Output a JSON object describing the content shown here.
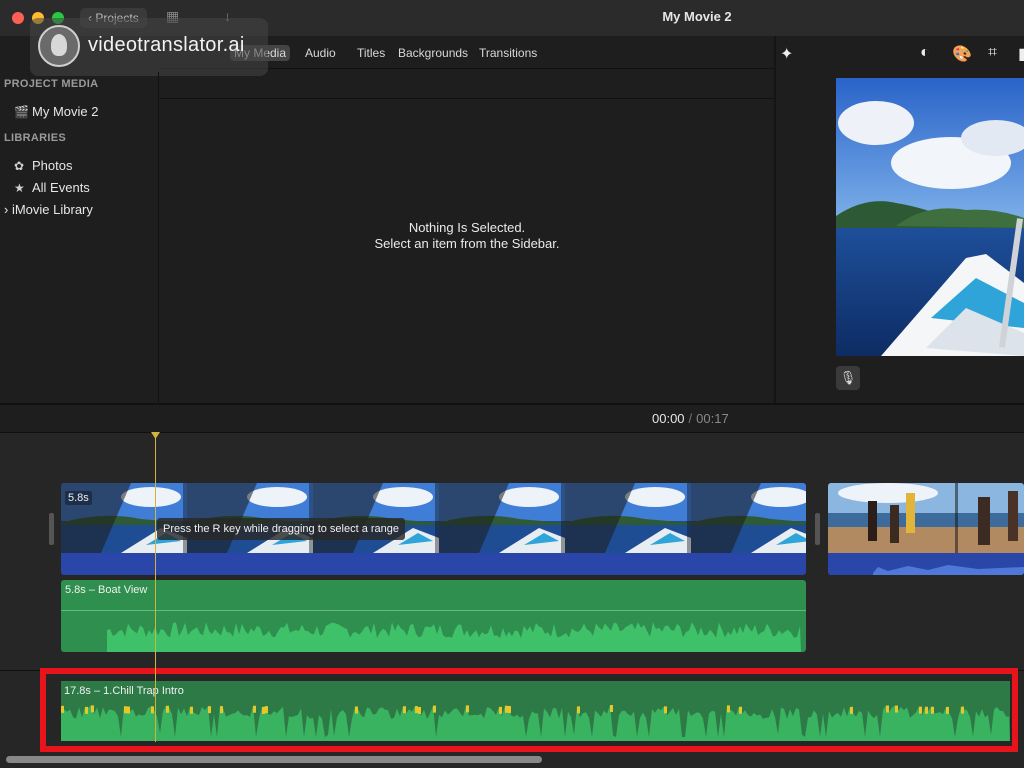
{
  "titlebar": {
    "projects_label": "Projects",
    "window_title": "My Movie 2"
  },
  "watermark": {
    "text": "videotranslator.ai"
  },
  "media_tabs": [
    {
      "label": "My Media",
      "active": true
    },
    {
      "label": "Audio",
      "active": false
    },
    {
      "label": "Titles",
      "active": false
    },
    {
      "label": "Backgrounds",
      "active": false
    },
    {
      "label": "Transitions",
      "active": false
    }
  ],
  "sidebar": {
    "project_media_header": "PROJECT MEDIA",
    "project_item": "My Movie 2",
    "libraries_header": "LIBRARIES",
    "photos": "Photos",
    "all_events": "All Events",
    "library": "iMovie Library"
  },
  "browser": {
    "empty_line1": "Nothing Is Selected.",
    "empty_line2": "Select an item from the Sidebar."
  },
  "viewer_tools": [
    "magic-wand-icon",
    "color-balance-icon",
    "color-palette-icon",
    "crop-icon"
  ],
  "timecode": {
    "current": "00:00",
    "separator": "/",
    "total": "00:17"
  },
  "timeline": {
    "main_clip_duration": "5.8s",
    "tooltip": "Press the R key while dragging to select a range",
    "attached_audio_label": "5.8s – Boat View",
    "music_label": "17.8s – 1.Chill Trap Intro"
  },
  "colors": {
    "highlight": "#e8141b",
    "audio_green": "#2f8f4e",
    "clip_blue": "#2a46a8",
    "playhead": "#d4b23e",
    "peak_yellow": "#e8c62a"
  }
}
